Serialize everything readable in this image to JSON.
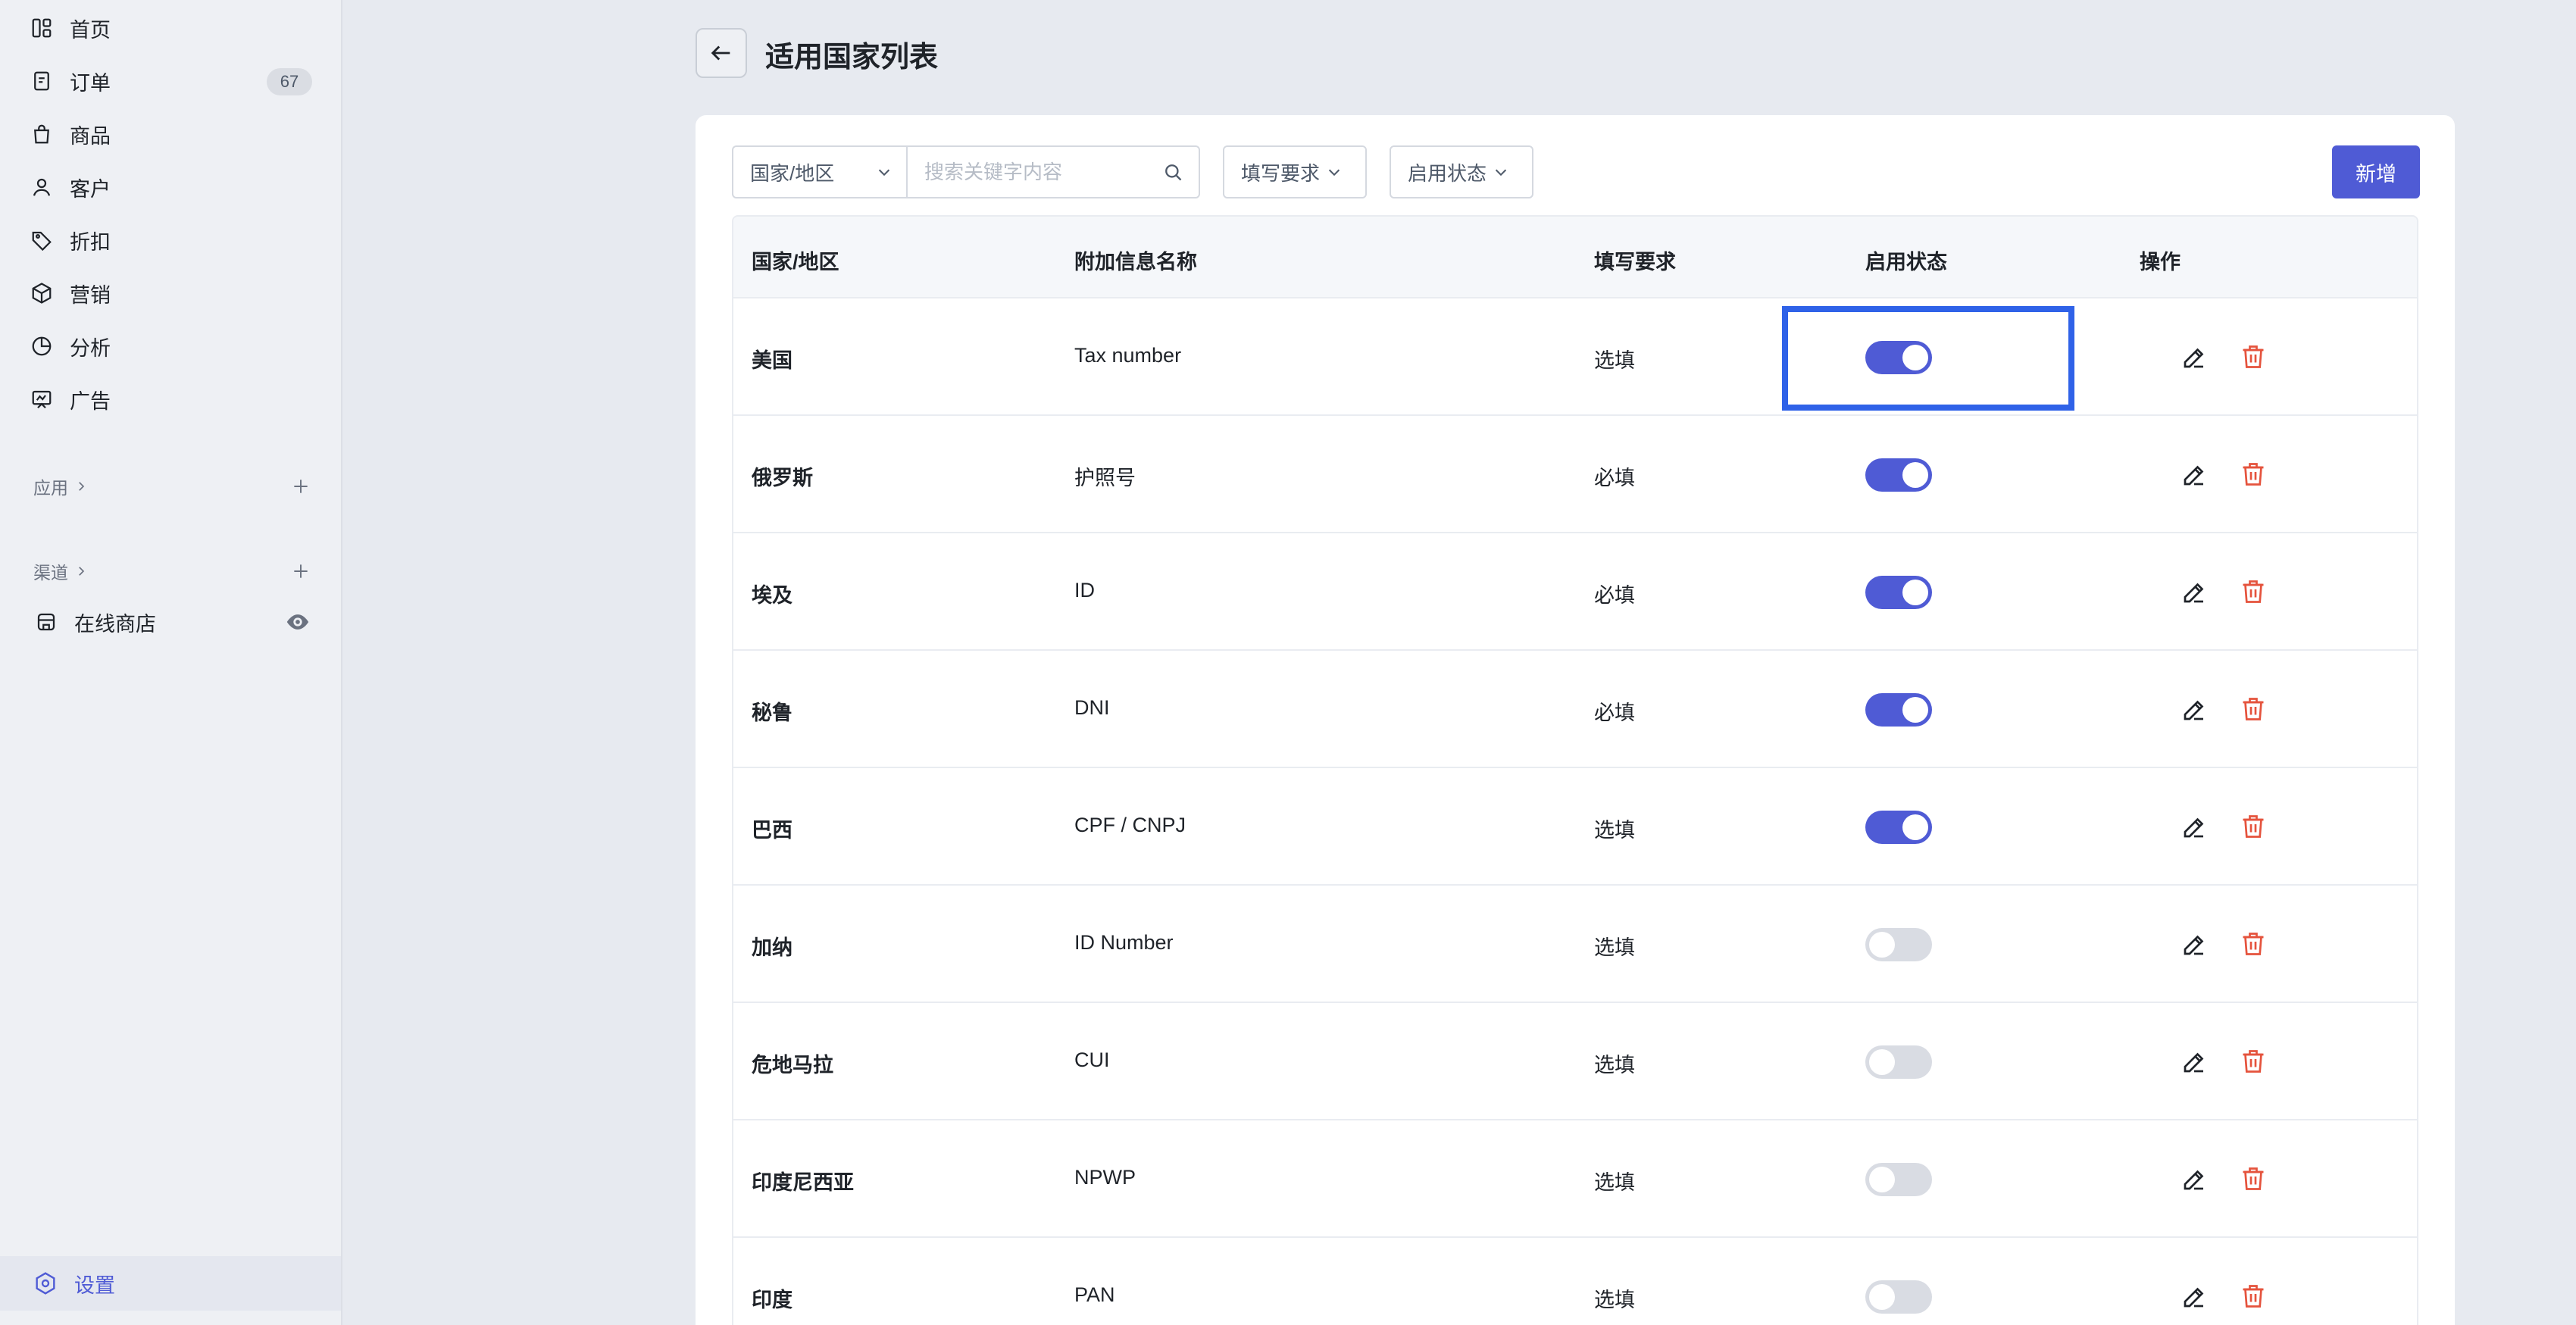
{
  "sidebar": {
    "items": [
      {
        "label": "首页",
        "icon": "home-icon"
      },
      {
        "label": "订单",
        "icon": "order-icon",
        "badge": "67"
      },
      {
        "label": "商品",
        "icon": "bag-icon"
      },
      {
        "label": "客户",
        "icon": "user-icon"
      },
      {
        "label": "折扣",
        "icon": "tag-icon"
      },
      {
        "label": "营销",
        "icon": "cube-icon"
      },
      {
        "label": "分析",
        "icon": "pie-icon"
      },
      {
        "label": "广告",
        "icon": "ad-icon"
      }
    ],
    "apps_label": "应用",
    "channels_label": "渠道",
    "online_store_label": "在线商店",
    "settings_label": "设置"
  },
  "header": {
    "title": "适用国家列表"
  },
  "filters": {
    "country_select": "国家/地区",
    "search_placeholder": "搜索关键字内容",
    "requirement_select": "填写要求",
    "status_select": "启用状态",
    "add_button": "新增"
  },
  "table": {
    "columns": [
      "国家/地区",
      "附加信息名称",
      "填写要求",
      "启用状态",
      "操作"
    ],
    "rows": [
      {
        "country": "美国",
        "name": "Tax number",
        "requirement": "选填",
        "enabled": true
      },
      {
        "country": "俄罗斯",
        "name": "护照号",
        "requirement": "必填",
        "enabled": true
      },
      {
        "country": "埃及",
        "name": "ID",
        "requirement": "必填",
        "enabled": true
      },
      {
        "country": "秘鲁",
        "name": "DNI",
        "requirement": "必填",
        "enabled": true
      },
      {
        "country": "巴西",
        "name": "CPF / CNPJ",
        "requirement": "选填",
        "enabled": true
      },
      {
        "country": "加纳",
        "name": "ID Number",
        "requirement": "选填",
        "enabled": false
      },
      {
        "country": "危地马拉",
        "name": "CUI",
        "requirement": "选填",
        "enabled": false
      },
      {
        "country": "印度尼西亚",
        "name": "NPWP",
        "requirement": "选填",
        "enabled": false
      },
      {
        "country": "印度",
        "name": "PAN",
        "requirement": "选填",
        "enabled": false
      }
    ]
  },
  "colors": {
    "accent": "#4f5bd5",
    "delete": "#e5533d",
    "highlight": "#2f62e8"
  }
}
